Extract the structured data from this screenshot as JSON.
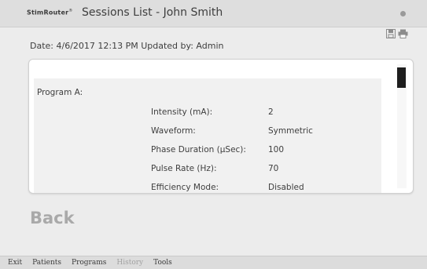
{
  "header": {
    "brand": "StimRouter",
    "brand_mark": "®",
    "title": "Sessions List - John Smith"
  },
  "toolbar": {
    "icons": [
      "save-icon",
      "print-icon"
    ]
  },
  "session": {
    "date_line": "Date: 4/6/2017 12:13 PM Updated by: Admin"
  },
  "program": {
    "label": "Program A:",
    "params": [
      {
        "key": "Intensity (mA):",
        "value": "2"
      },
      {
        "key": "Waveform:",
        "value": "Symmetric"
      },
      {
        "key": "Phase Duration (µSec):",
        "value": "100"
      },
      {
        "key": "Pulse Rate (Hz):",
        "value": "70"
      },
      {
        "key": "Efficiency Mode:",
        "value": "Disabled"
      }
    ]
  },
  "actions": {
    "back_label": "Back"
  },
  "nav": {
    "items": [
      {
        "label": "Exit",
        "active": true
      },
      {
        "label": "Patients",
        "active": true
      },
      {
        "label": "Programs",
        "active": true
      },
      {
        "label": "History",
        "active": false
      },
      {
        "label": "Tools",
        "active": true
      }
    ]
  },
  "colors": {
    "background": "#ececec",
    "titlebar": "#dedede",
    "card": "#ffffff",
    "muted_text": "#a9a9a9",
    "scroll_thumb": "#1e1e1e"
  }
}
